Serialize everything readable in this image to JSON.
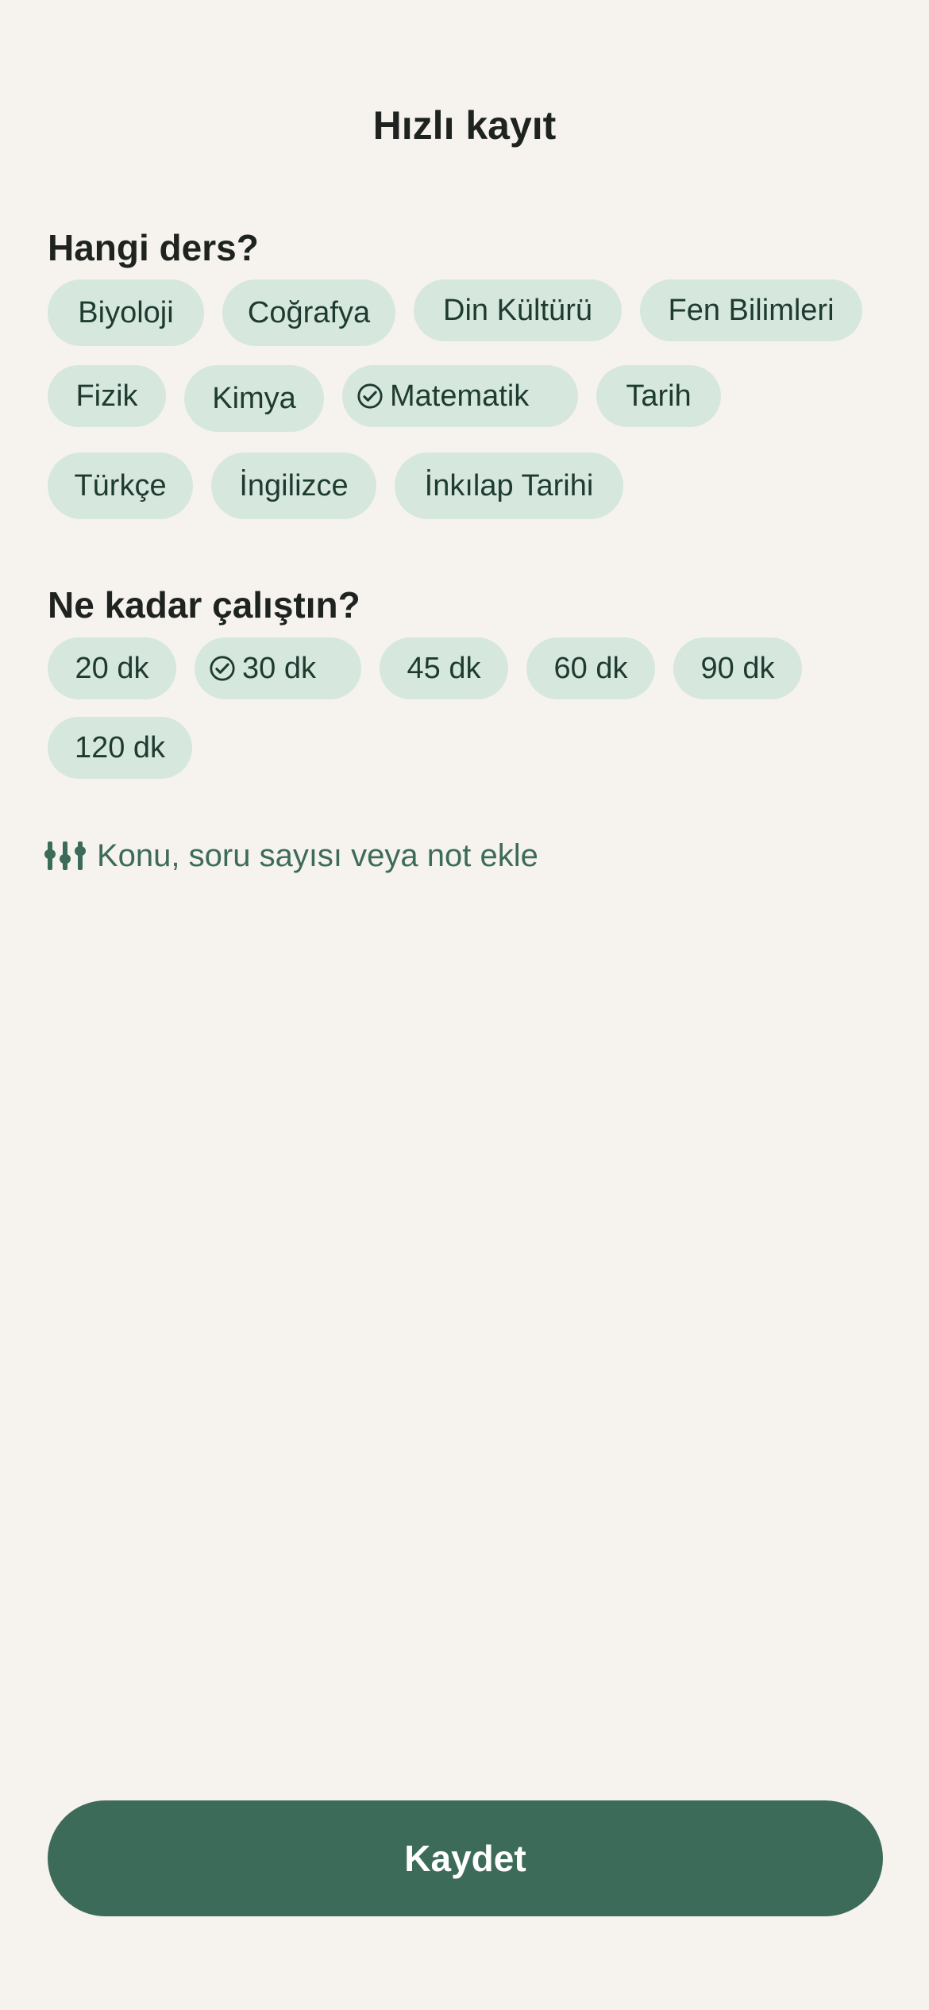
{
  "header": {
    "title": "Hızlı kayıt"
  },
  "subject_section": {
    "label": "Hangi ders?",
    "chips": [
      {
        "label": "Biyoloji",
        "selected": false
      },
      {
        "label": "Coğrafya",
        "selected": false
      },
      {
        "label": "Din Kültürü",
        "selected": false
      },
      {
        "label": "Fen Bilimleri",
        "selected": false
      },
      {
        "label": "Fizik",
        "selected": false
      },
      {
        "label": "Kimya",
        "selected": false
      },
      {
        "label": "Matematik",
        "selected": true
      },
      {
        "label": "Tarih",
        "selected": false
      },
      {
        "label": "Türkçe",
        "selected": false
      },
      {
        "label": "İngilizce",
        "selected": false
      },
      {
        "label": "İnkılap Tarihi",
        "selected": false
      }
    ]
  },
  "duration_section": {
    "label": "Ne kadar çalıştın?",
    "chips": [
      {
        "label": "20 dk",
        "selected": false
      },
      {
        "label": "30 dk",
        "selected": true
      },
      {
        "label": "45 dk",
        "selected": false
      },
      {
        "label": "60 dk",
        "selected": false
      },
      {
        "label": "90 dk",
        "selected": false
      },
      {
        "label": "120 dk",
        "selected": false
      }
    ]
  },
  "details_option": {
    "icon": "sliders-icon",
    "label": "Konu, soru sayısı veya not ekle"
  },
  "save_button": {
    "label": "Kaydet"
  },
  "colors": {
    "background": "#f6f3ef",
    "chip": "#d6e7de",
    "chip_text": "#1e3b30",
    "accent": "#3d6b5a"
  }
}
